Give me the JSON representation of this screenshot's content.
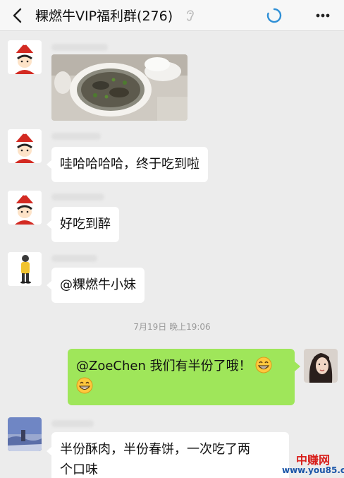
{
  "header": {
    "title": "粿燃牛VIP福利群(276)"
  },
  "messages": [
    {
      "type": "image",
      "side": "left",
      "avatar": "santa-hat-cartoon-avatar"
    },
    {
      "type": "text",
      "side": "left",
      "avatar": "santa-hat-cartoon-avatar",
      "text": "哇哈哈哈哈，终于吃到啦"
    },
    {
      "type": "text",
      "side": "left",
      "avatar": "santa-hat-cartoon-avatar",
      "text": "好吃到醉"
    },
    {
      "type": "text",
      "side": "left",
      "avatar": "yellow-figure-avatar",
      "text": "@粿燃牛小妹"
    },
    {
      "type": "timestamp",
      "text": "7月19日 晚上19:06"
    },
    {
      "type": "text",
      "side": "right",
      "avatar": "woman-photo-avatar",
      "text": "@ZoeChen  我们有半份了哦！",
      "emoji": "grinning-face"
    },
    {
      "type": "text",
      "side": "left",
      "avatar": "landscape-photo-avatar",
      "text_line1": "半份酥肉，半份春饼，一次吃了两",
      "text_line2": "个口味"
    }
  ],
  "watermark": {
    "name": "中赚网",
    "url": "www.you85.com"
  },
  "colors": {
    "my_bubble": "#9fe65a",
    "their_bubble": "#ffffff",
    "background": "#ececec",
    "loading_ring": "#2e8fd6"
  }
}
